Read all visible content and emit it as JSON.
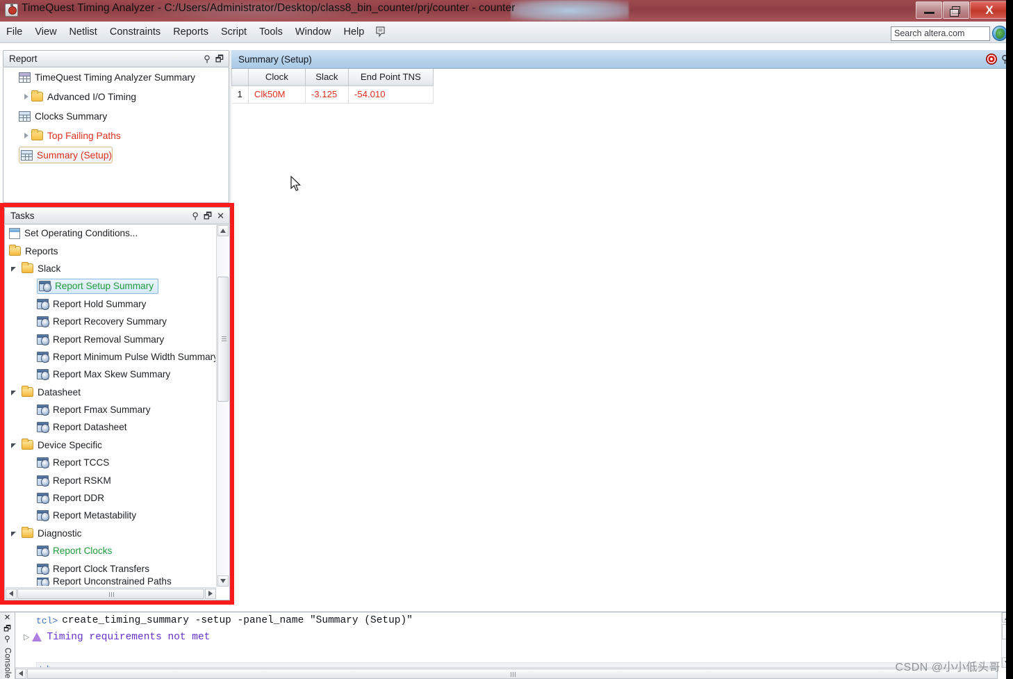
{
  "window": {
    "title": "TimeQuest Timing Analyzer - C:/Users/Administrator/Desktop/class8_bin_counter/prj/counter - counter",
    "app_icon": "timequest-icon",
    "controls": {
      "minimize": "minimize-icon",
      "maximize": "restore-icon",
      "close": "X"
    }
  },
  "menubar": {
    "items": [
      "File",
      "View",
      "Netlist",
      "Constraints",
      "Reports",
      "Script",
      "Tools",
      "Window",
      "Help"
    ],
    "memo_icon": "note-icon"
  },
  "search": {
    "value": "Search altera.com",
    "placeholder": "Search altera.com",
    "globe_icon": "globe-icon"
  },
  "report_panel": {
    "title": "Report",
    "tools": [
      "pin-icon",
      "restore-icon"
    ],
    "items": [
      {
        "label": "TimeQuest Timing Analyzer Summary",
        "icon": "table-icon",
        "indent": 1,
        "arrow": "none",
        "color": "normal"
      },
      {
        "label": "Advanced I/O Timing",
        "icon": "folder-icon",
        "indent": 0,
        "arrow": "closed",
        "color": "normal"
      },
      {
        "label": "Clocks Summary",
        "icon": "grid-icon",
        "indent": 1,
        "arrow": "none",
        "color": "normal"
      },
      {
        "label": "Top Failing Paths",
        "icon": "folder-icon",
        "indent": 0,
        "arrow": "closed",
        "color": "red"
      },
      {
        "label": "Summary (Setup)",
        "icon": "grid-icon",
        "indent": 1,
        "arrow": "none",
        "color": "red",
        "selected": true
      }
    ]
  },
  "tasks_panel": {
    "title": "Tasks",
    "tools": [
      "pin-icon",
      "restore-icon",
      "close-icon"
    ],
    "highlight_color": "#fa1c1c",
    "items": [
      {
        "label": "Set Operating Conditions...",
        "icon": "document-icon",
        "indent": 0,
        "arrow": "none",
        "state": "normal"
      },
      {
        "label": "Reports",
        "icon": "folder-open-icon",
        "indent": 0,
        "arrow": "none",
        "state": "normal"
      },
      {
        "label": "Slack",
        "icon": "folder-open-icon",
        "indent": 1,
        "arrow": "open",
        "state": "normal"
      },
      {
        "label": "Report Setup Summary",
        "icon": "task-icon",
        "indent": 2,
        "arrow": "none",
        "state": "selected",
        "marker": "green-check"
      },
      {
        "label": "Report Hold Summary",
        "icon": "task-icon",
        "indent": 2,
        "arrow": "none",
        "state": "normal"
      },
      {
        "label": "Report Recovery Summary",
        "icon": "task-icon",
        "indent": 2,
        "arrow": "none",
        "state": "normal"
      },
      {
        "label": "Report Removal Summary",
        "icon": "task-icon",
        "indent": 2,
        "arrow": "none",
        "state": "normal"
      },
      {
        "label": "Report Minimum Pulse Width Summary",
        "icon": "task-icon",
        "indent": 2,
        "arrow": "none",
        "state": "normal"
      },
      {
        "label": "Report Max Skew Summary",
        "icon": "task-icon",
        "indent": 2,
        "arrow": "none",
        "state": "normal"
      },
      {
        "label": "Datasheet",
        "icon": "folder-open-icon",
        "indent": 1,
        "arrow": "open",
        "state": "normal"
      },
      {
        "label": "Report Fmax Summary",
        "icon": "task-icon",
        "indent": 2,
        "arrow": "none",
        "state": "normal"
      },
      {
        "label": "Report Datasheet",
        "icon": "task-icon",
        "indent": 2,
        "arrow": "none",
        "state": "normal"
      },
      {
        "label": "Device Specific",
        "icon": "folder-open-icon",
        "indent": 1,
        "arrow": "open",
        "state": "normal"
      },
      {
        "label": "Report TCCS",
        "icon": "task-icon",
        "indent": 2,
        "arrow": "none",
        "state": "normal"
      },
      {
        "label": "Report RSKM",
        "icon": "task-icon",
        "indent": 2,
        "arrow": "none",
        "state": "normal"
      },
      {
        "label": "Report DDR",
        "icon": "task-icon",
        "indent": 2,
        "arrow": "none",
        "state": "normal"
      },
      {
        "label": "Report Metastability",
        "icon": "task-icon",
        "indent": 2,
        "arrow": "none",
        "state": "normal"
      },
      {
        "label": "Diagnostic",
        "icon": "folder-open-icon",
        "indent": 1,
        "arrow": "open",
        "state": "normal"
      },
      {
        "label": "Report Clocks",
        "icon": "task-icon",
        "indent": 2,
        "arrow": "none",
        "state": "green",
        "marker": "green-check"
      },
      {
        "label": "Report Clock Transfers",
        "icon": "task-icon",
        "indent": 2,
        "arrow": "none",
        "state": "normal"
      },
      {
        "label": "Report Unconstrained Paths",
        "icon": "task-icon",
        "indent": 2,
        "arrow": "none",
        "state": "clipped"
      }
    ]
  },
  "document": {
    "tab_label": "Summary (Setup)",
    "tools": [
      "record-icon",
      "pin-icon"
    ],
    "table": {
      "columns": [
        "",
        "Clock",
        "Slack",
        "End Point TNS"
      ],
      "rows": [
        {
          "num": "1",
          "clock": "Clk50M",
          "slack": "-3.125",
          "end_point_tns": "-54.010"
        }
      ],
      "value_color": "#e03020"
    }
  },
  "console": {
    "dock_label": "Console",
    "dock_icons": [
      "close-icon",
      "restore-icon",
      "pin-icon"
    ],
    "lines": [
      {
        "prompt": "tcl>",
        "text": "create_timing_summary -setup -panel_name \"Summary (Setup)\"",
        "type": "command"
      },
      {
        "prompt": "",
        "text": "Timing requirements not met",
        "type": "warning",
        "icon": "warning-triangle-icon",
        "expander": "collapsed-arrow"
      }
    ],
    "input_prompt": "tcl>",
    "input_value": ""
  },
  "watermark": {
    "text": "CSDN @小小低头哥"
  }
}
